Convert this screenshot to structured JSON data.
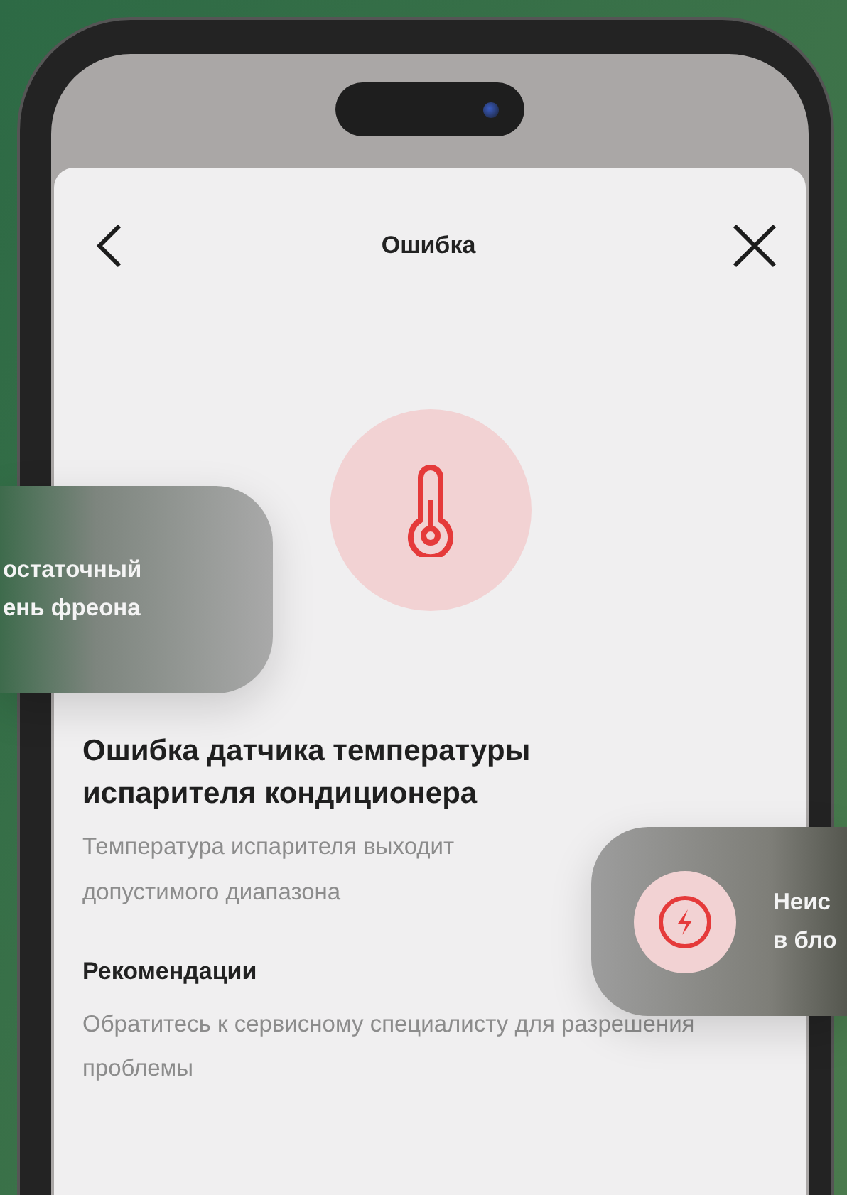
{
  "screen": {
    "title": "Ошибка",
    "error": {
      "title": "Ошибка датчика температуры испарителя кондиционера",
      "description_lines": [
        "Температура испарителя выходит",
        "допустимого диапазона"
      ]
    },
    "recommendations": {
      "heading": "Рекомендации",
      "text": "Обратитесь к сервисному специалисту для разрешения проблемы"
    }
  },
  "floating_cards": [
    {
      "kind": "text",
      "lines": [
        "остаточный",
        "ень фреона"
      ]
    },
    {
      "kind": "icon",
      "lines": [
        "Неис",
        "в бло"
      ]
    }
  ]
}
